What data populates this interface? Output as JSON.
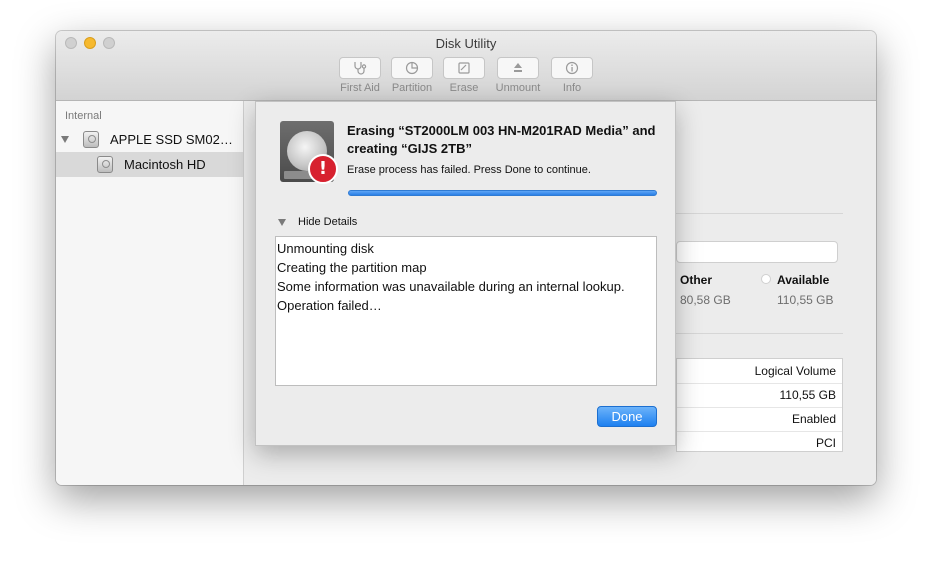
{
  "window": {
    "title": "Disk Utility"
  },
  "toolbar": {
    "buttons": [
      {
        "label": "First Aid",
        "icon": "stethoscope-icon"
      },
      {
        "label": "Partition",
        "icon": "pie-partition-icon"
      },
      {
        "label": "Erase",
        "icon": "erase-icon"
      },
      {
        "label": "Unmount",
        "icon": "eject-icon"
      },
      {
        "label": "Info",
        "icon": "info-icon"
      }
    ]
  },
  "sidebar": {
    "section": "Internal",
    "disk": "APPLE SSD SM02…",
    "volume": "Macintosh HD"
  },
  "main": {
    "legend": [
      {
        "title": "Other",
        "value": "80,58 GB"
      },
      {
        "title": "Available",
        "value": "110,55 GB"
      }
    ],
    "info_values": [
      "Logical Volume",
      "110,55 GB",
      "Enabled",
      "PCI"
    ]
  },
  "sheet": {
    "title": "Erasing “ST2000LM 003 HN-M201RAD Media” and creating “GIJS 2TB”",
    "status": "Erase process has failed. Press Done to continue.",
    "progress": 1.0,
    "details_toggle": "Hide Details",
    "log": [
      "Unmounting disk",
      "Creating the partition map",
      "Some information was unavailable during an internal lookup.",
      "Operation failed…"
    ],
    "done_label": "Done",
    "warning_glyph": "!"
  },
  "colors": {
    "accent": "#2a7fe6",
    "warning": "#d7212f",
    "minimize": "#f6b92e"
  }
}
